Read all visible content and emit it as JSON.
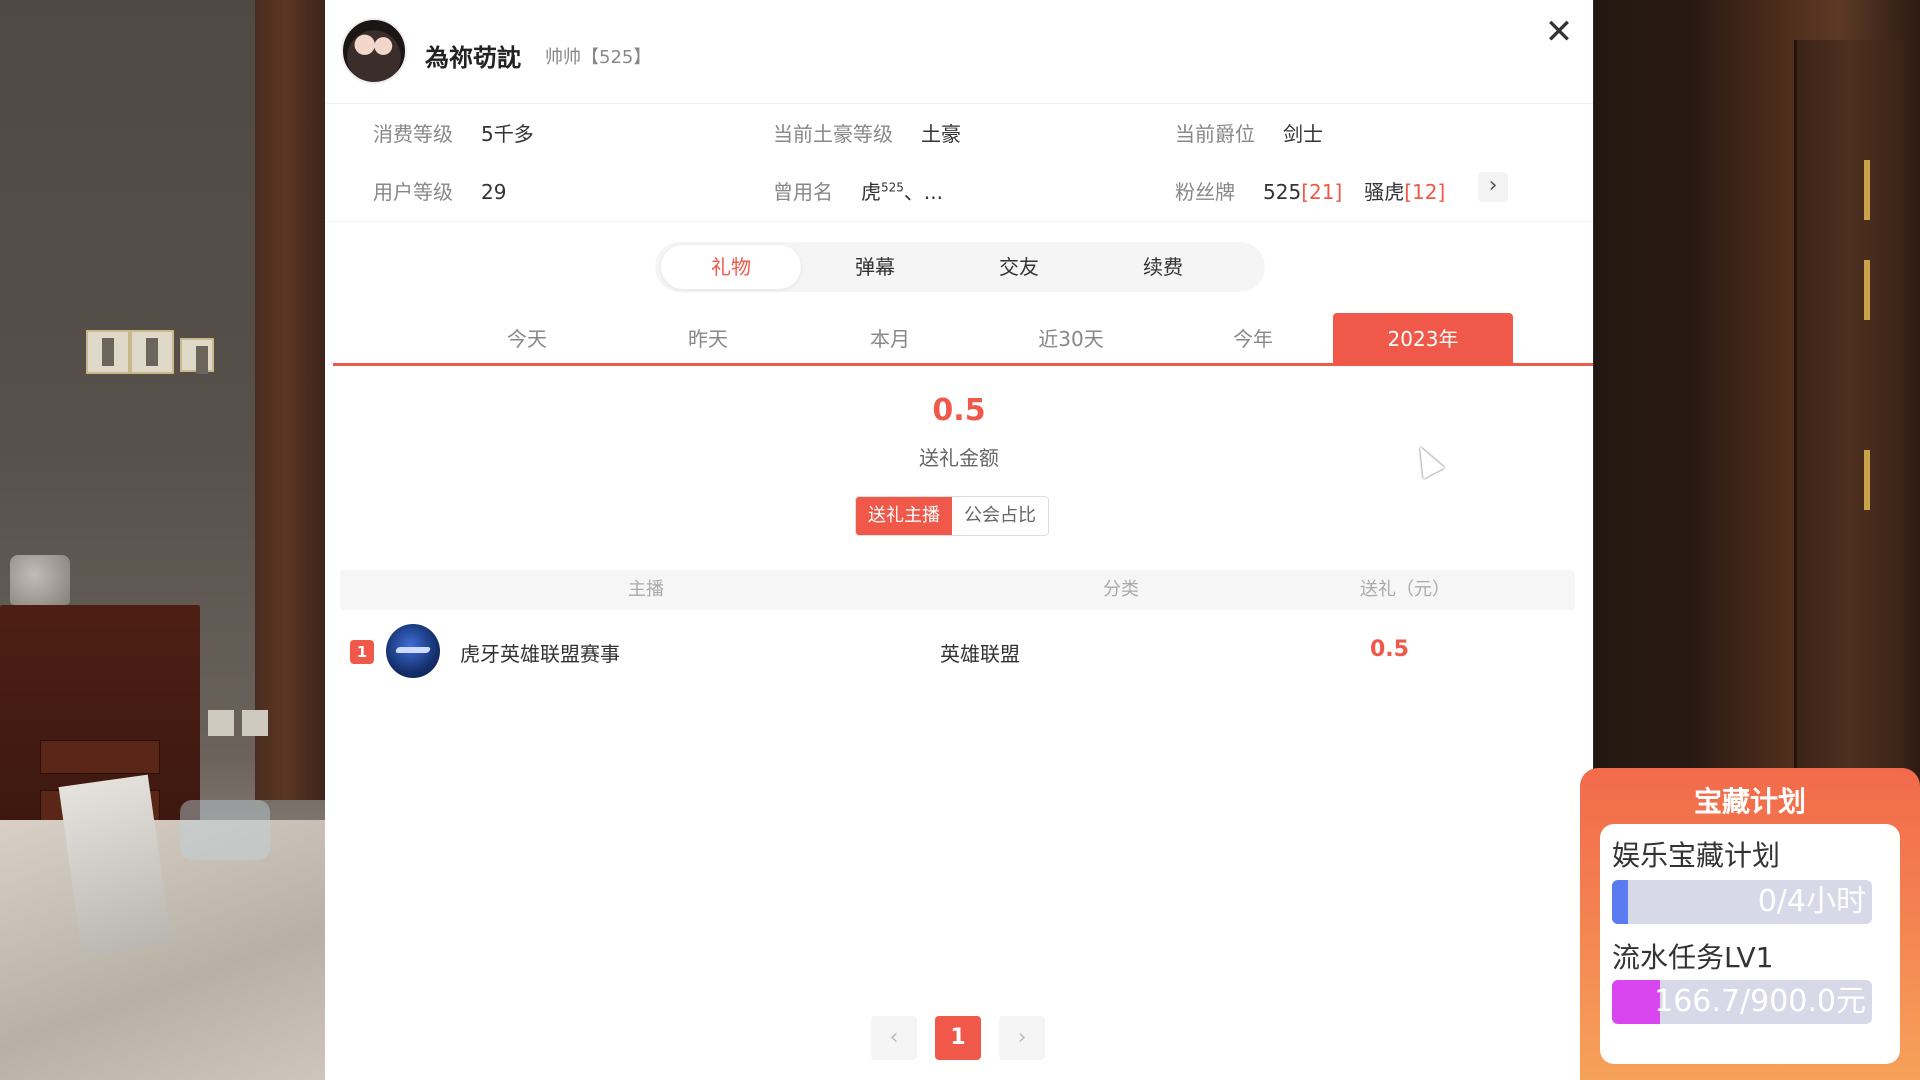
{
  "header": {
    "nickname": "為祢苆訦",
    "tagline": "帅帅【525】",
    "close_symbol": "✕"
  },
  "info": {
    "spend_level_label": "消费等级",
    "spend_level_value": "5千多",
    "tuhao_label": "当前土豪等级",
    "tuhao_value": "土豪",
    "rank_label": "当前爵位",
    "rank_value": "剑士",
    "user_level_label": "用户等级",
    "user_level_value": "29",
    "former_name_label": "曾用名",
    "former_name_value": "虎",
    "former_name_sup": "525",
    "former_name_more": "、...",
    "fan_badge_label": "粉丝牌",
    "fan_badge_1_name": "525",
    "fan_badge_1_level": "[21]",
    "fan_badge_2_name": "骚虎",
    "fan_badge_2_level": "[12]",
    "fan_badge_next": "›"
  },
  "tabs": [
    {
      "label": "礼物",
      "active": true
    },
    {
      "label": "弹幕",
      "active": false
    },
    {
      "label": "交友",
      "active": false
    },
    {
      "label": "续费",
      "active": false
    }
  ],
  "periods": [
    {
      "label": "今天"
    },
    {
      "label": "昨天"
    },
    {
      "label": "本月"
    },
    {
      "label": "近30天"
    },
    {
      "label": "今年"
    },
    {
      "label": "2023年",
      "active": true
    }
  ],
  "summary": {
    "amount": "0.5",
    "amount_label": "送礼金额"
  },
  "segment": {
    "option_1": "送礼主播",
    "option_2": "公会占比"
  },
  "table": {
    "columns": [
      "主播",
      "分类",
      "送礼（元）"
    ],
    "rows": [
      {
        "rank": "1",
        "streamer": "虎牙英雄联盟赛事",
        "category": "英雄联盟",
        "gift": "0.5"
      }
    ]
  },
  "pagination": {
    "prev": "‹",
    "current": "1",
    "next": "›"
  },
  "treasure": {
    "title": "宝藏计划",
    "task_1_label": "娱乐宝藏计划",
    "task_1_progress_text": "0/4小时",
    "task_1_progress": 0.0,
    "task_2_label": "流水任务LV1",
    "task_2_progress_text": "166.7/900.0元",
    "task_2_progress": 0.185
  },
  "colors": {
    "accent": "#f0584a",
    "task_1_fill": "#5b7cf0",
    "task_2_fill": "#d946ef"
  }
}
